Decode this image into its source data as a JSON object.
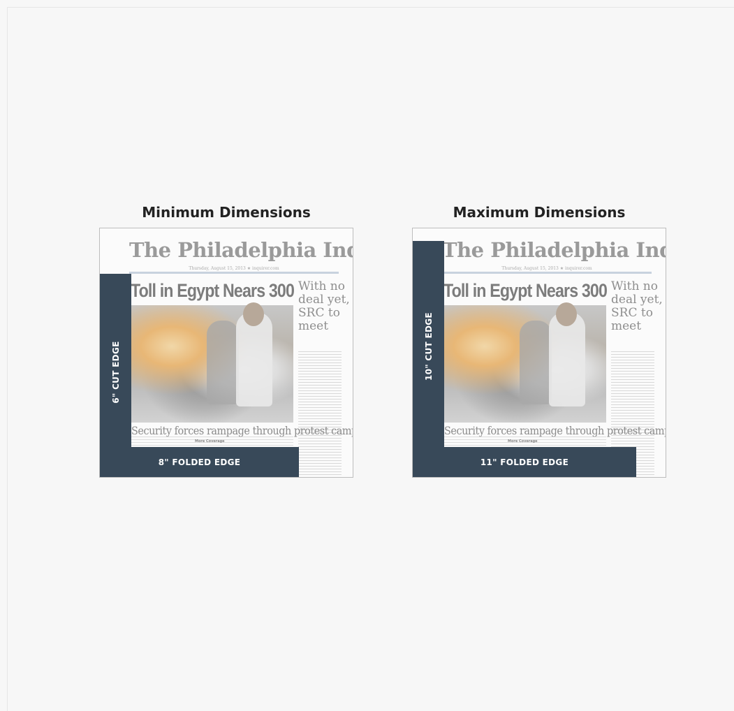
{
  "panels": [
    {
      "title": "Minimum Dimensions",
      "cut_edge_label": "6\" CUT EDGE",
      "folded_edge_label": "8\" FOLDED EDGE"
    },
    {
      "title": "Maximum Dimensions",
      "cut_edge_label": "10\" CUT EDGE",
      "folded_edge_label": "11\" FOLDED EDGE"
    }
  ],
  "newspaper": {
    "masthead": "The Philadelphia Inquirer",
    "dateline": "Thursday, August 15, 2013 ★ inquirer.com",
    "headline": "Toll in Egypt Nears 300",
    "side_headline": "With no deal yet, SRC to meet",
    "subheadline": "Security forces rampage through protest camps",
    "more_coverage": "More Coverage"
  },
  "colors": {
    "dimension_bar": "#384959",
    "background": "#f7f7f7"
  }
}
